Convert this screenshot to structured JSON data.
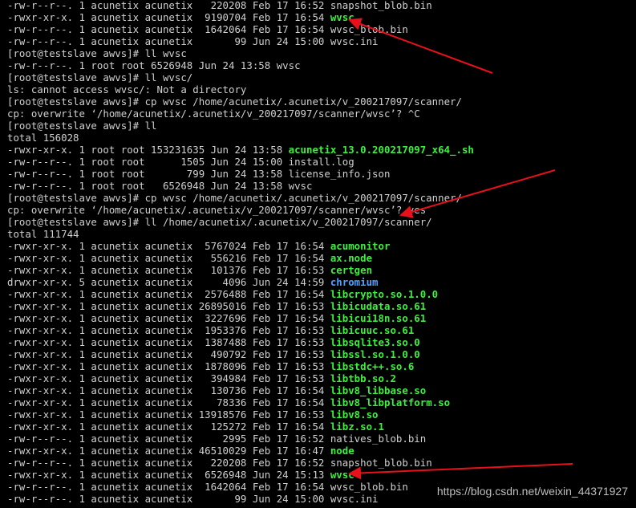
{
  "terminal": {
    "lines": [
      {
        "text": "-rw-r--r--. 1 acunetix acunetix   220208 Feb 17 16:52 ",
        "name": "snapshot_blob.bin",
        "color": "default"
      },
      {
        "text": "-rwxr-xr-x. 1 acunetix acunetix  9190704 Feb 17 16:54 ",
        "name": "wvsc",
        "color": "green"
      },
      {
        "text": "-rw-r--r--. 1 acunetix acunetix  1642064 Feb 17 16:54 ",
        "name": "wvsc_blob.bin",
        "color": "default"
      },
      {
        "text": "-rw-r--r--. 1 acunetix acunetix       99 Jun 24 15:00 ",
        "name": "wvsc.ini",
        "color": "default"
      },
      {
        "text": "[root@testslave awvs]# ll wvsc"
      },
      {
        "text": "-rw-r--r--. 1 root root 6526948 Jun 24 13:58 wvsc"
      },
      {
        "text": "[root@testslave awvs]# ll wvsc/"
      },
      {
        "text": "ls: cannot access wvsc/: Not a directory"
      },
      {
        "text": "[root@testslave awvs]# cp wvsc /home/acunetix/.acunetix/v_200217097/scanner/"
      },
      {
        "text": "cp: overwrite ‘/home/acunetix/.acunetix/v_200217097/scanner/wvsc’? ^C"
      },
      {
        "text": "[root@testslave awvs]# ll"
      },
      {
        "text": "total 156028"
      },
      {
        "text": "-rwxr-xr-x. 1 root root 153231635 Jun 24 13:58 ",
        "name": "acunetix_13.0.200217097_x64_.sh",
        "color": "green"
      },
      {
        "text": "-rw-r--r--. 1 root root      1505 Jun 24 15:00 install.log"
      },
      {
        "text": "-rw-r--r--. 1 root root       799 Jun 24 13:58 license_info.json"
      },
      {
        "text": "-rw-r--r--. 1 root root   6526948 Jun 24 13:58 wvsc"
      },
      {
        "text": "[root@testslave awvs]# cp wvsc /home/acunetix/.acunetix/v_200217097/scanner/"
      },
      {
        "text": "cp: overwrite ‘/home/acunetix/.acunetix/v_200217097/scanner/wvsc’? yes"
      },
      {
        "text": "[root@testslave awvs]# ll /home/acunetix/.acunetix/v_200217097/scanner/"
      },
      {
        "text": "total 111744"
      },
      {
        "text": "-rwxr-xr-x. 1 acunetix acunetix  5767024 Feb 17 16:54 ",
        "name": "acumonitor",
        "color": "green"
      },
      {
        "text": "-rwxr-xr-x. 1 acunetix acunetix   556216 Feb 17 16:54 ",
        "name": "ax.node",
        "color": "green"
      },
      {
        "text": "-rwxr-xr-x. 1 acunetix acunetix   101376 Feb 17 16:53 ",
        "name": "certgen",
        "color": "green"
      },
      {
        "text": "drwxr-xr-x. 5 acunetix acunetix     4096 Jun 24 14:59 ",
        "name": "chromium",
        "color": "blue"
      },
      {
        "text": "-rwxr-xr-x. 1 acunetix acunetix  2576488 Feb 17 16:54 ",
        "name": "libcrypto.so.1.0.0",
        "color": "green"
      },
      {
        "text": "-rwxr-xr-x. 1 acunetix acunetix 26895016 Feb 17 16:53 ",
        "name": "libicudata.so.61",
        "color": "green"
      },
      {
        "text": "-rwxr-xr-x. 1 acunetix acunetix  3227696 Feb 17 16:54 ",
        "name": "libicui18n.so.61",
        "color": "green"
      },
      {
        "text": "-rwxr-xr-x. 1 acunetix acunetix  1953376 Feb 17 16:53 ",
        "name": "libicuuc.so.61",
        "color": "green"
      },
      {
        "text": "-rwxr-xr-x. 1 acunetix acunetix  1387488 Feb 17 16:53 ",
        "name": "libsqlite3.so.0",
        "color": "green"
      },
      {
        "text": "-rwxr-xr-x. 1 acunetix acunetix   490792 Feb 17 16:53 ",
        "name": "libssl.so.1.0.0",
        "color": "green"
      },
      {
        "text": "-rwxr-xr-x. 1 acunetix acunetix  1878096 Feb 17 16:53 ",
        "name": "libstdc++.so.6",
        "color": "green"
      },
      {
        "text": "-rwxr-xr-x. 1 acunetix acunetix   394984 Feb 17 16:53 ",
        "name": "libtbb.so.2",
        "color": "green"
      },
      {
        "text": "-rwxr-xr-x. 1 acunetix acunetix   130736 Feb 17 16:54 ",
        "name": "libv8_libbase.so",
        "color": "green"
      },
      {
        "text": "-rwxr-xr-x. 1 acunetix acunetix    78336 Feb 17 16:54 ",
        "name": "libv8_libplatform.so",
        "color": "green"
      },
      {
        "text": "-rwxr-xr-x. 1 acunetix acunetix 13918576 Feb 17 16:53 ",
        "name": "libv8.so",
        "color": "green"
      },
      {
        "text": "-rwxr-xr-x. 1 acunetix acunetix   125272 Feb 17 16:54 ",
        "name": "libz.so.1",
        "color": "green"
      },
      {
        "text": "-rw-r--r--. 1 acunetix acunetix     2995 Feb 17 16:52 ",
        "name": "natives_blob.bin",
        "color": "default"
      },
      {
        "text": "-rwxr-xr-x. 1 acunetix acunetix 46510029 Feb 17 16:47 ",
        "name": "node",
        "color": "green"
      },
      {
        "text": "-rw-r--r--. 1 acunetix acunetix   220208 Feb 17 16:52 ",
        "name": "snapshot_blob.bin",
        "color": "default"
      },
      {
        "text": "-rwxr-xr-x. 1 acunetix acunetix  6526948 Jun 24 15:13 ",
        "name": "wvsc",
        "color": "green"
      },
      {
        "text": "-rw-r--r--. 1 acunetix acunetix  1642064 Feb 17 16:54 ",
        "name": "wvsc_blob.bin",
        "color": "default"
      },
      {
        "text": "-rw-r--r--. 1 acunetix acunetix       99 Jun 24 15:00 ",
        "name": "wvsc.ini",
        "color": "default"
      }
    ]
  },
  "watermark": "https://blog.csdn.net/weixin_44371927",
  "colors": {
    "background": "#000000",
    "text": "#d0d0d0",
    "executable": "#3ef03e",
    "directory": "#4fa0ff",
    "arrow": "#e8101a"
  }
}
